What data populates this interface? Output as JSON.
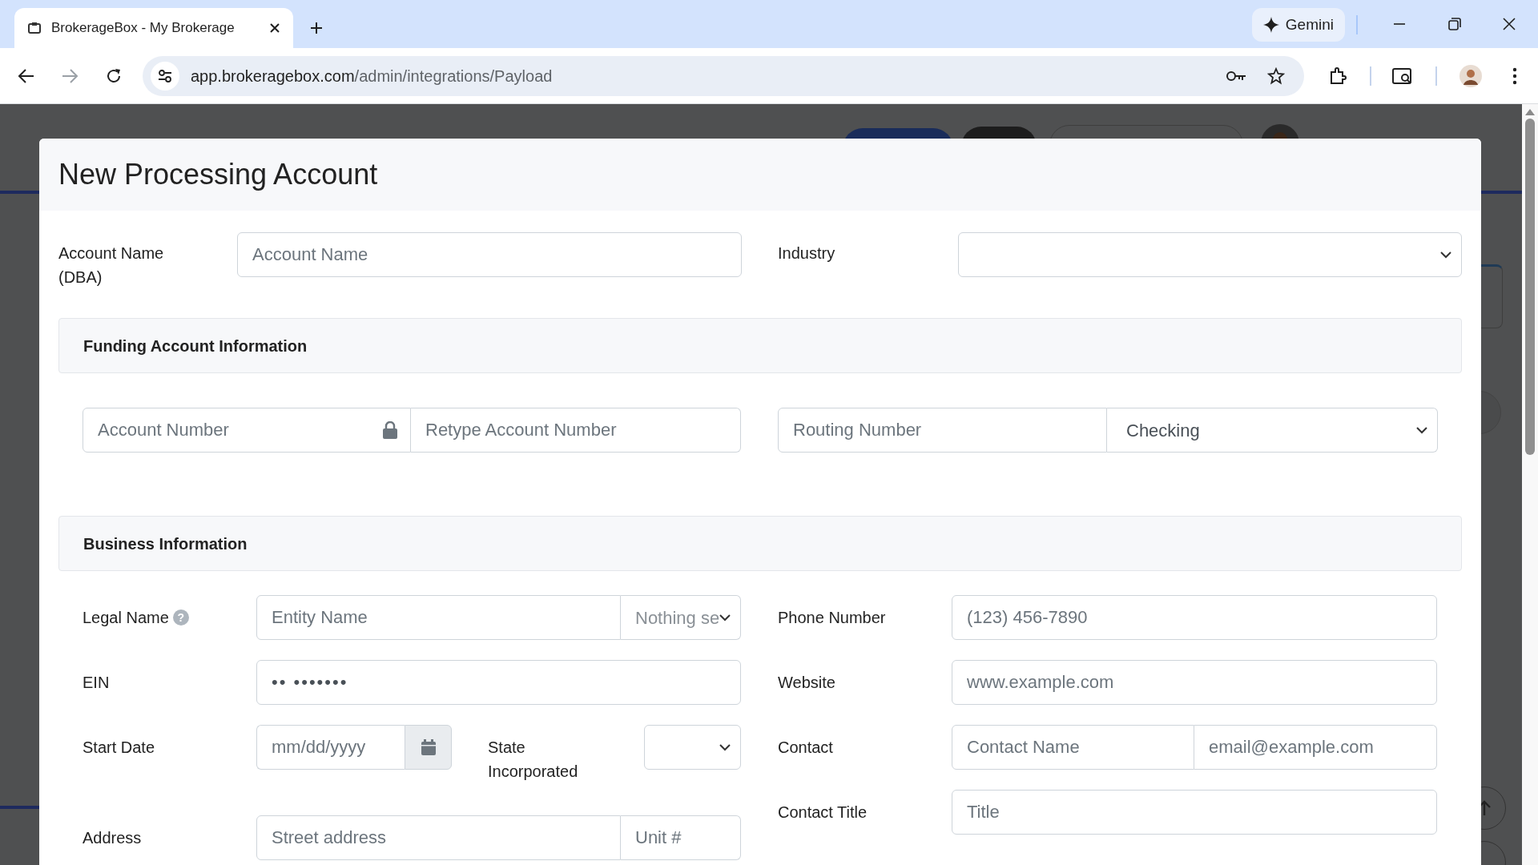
{
  "browser": {
    "tab_title": "BrokerageBox - My Brokerage",
    "url_host": "app.brokeragebox.com",
    "url_path": "/admin/integrations/Payload",
    "gemini_label": "Gemini"
  },
  "modal": {
    "title": "New Processing Account",
    "account_name": {
      "label": "Account Name (DBA)",
      "placeholder": "Account Name"
    },
    "industry": {
      "label": "Industry"
    },
    "funding": {
      "title": "Funding Account Information",
      "account_number": {
        "placeholder": "Account Number"
      },
      "retype_account_number": {
        "placeholder": "Retype Account Number"
      },
      "routing_number": {
        "placeholder": "Routing Number"
      },
      "account_type": {
        "value": "Checking"
      }
    },
    "business": {
      "title": "Business Information",
      "legal_name": {
        "label": "Legal Name",
        "help": "?",
        "placeholder": "Entity Name",
        "entity_type": "Nothing se"
      },
      "ein": {
        "label": "EIN",
        "value": "•• •••••••"
      },
      "start_date": {
        "label": "Start Date",
        "placeholder": "mm/dd/yyyy"
      },
      "state_incorporated": {
        "label": "State Incorporated"
      },
      "address": {
        "label": "Address",
        "placeholder": "Street address",
        "unit_placeholder": "Unit #"
      },
      "phone_number": {
        "label": "Phone Number",
        "placeholder": "(123) 456-7890"
      },
      "website": {
        "label": "Website",
        "placeholder": "www.example.com"
      },
      "contact": {
        "label": "Contact",
        "name_placeholder": "Contact Name",
        "email_placeholder": "email@example.com"
      },
      "contact_title": {
        "label": "Contact Title",
        "placeholder": "Title"
      }
    }
  }
}
